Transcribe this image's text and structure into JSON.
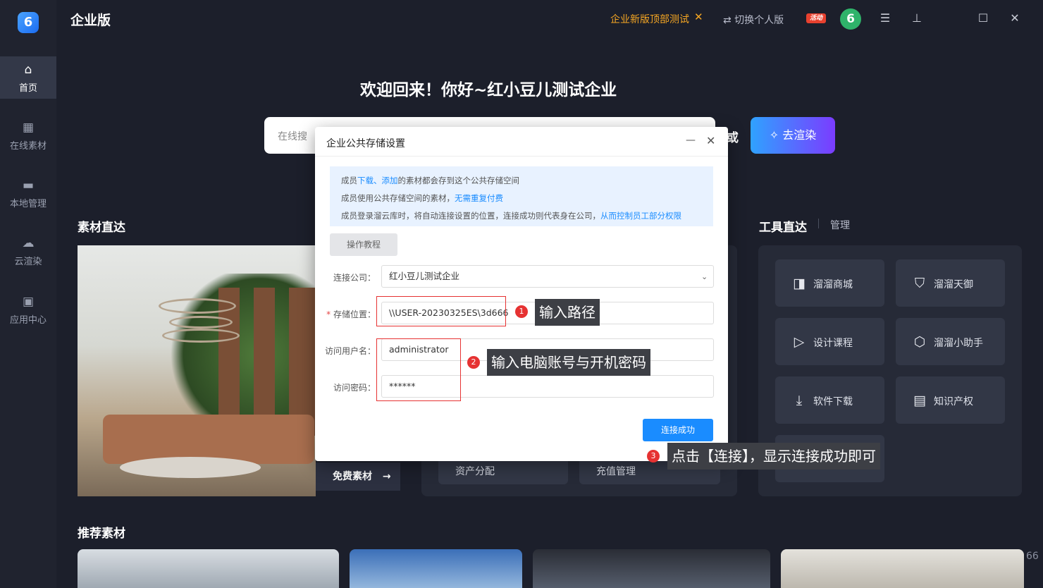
{
  "app": {
    "title": "企业版",
    "logo_glyph": "6",
    "top_notice": "企业新版顶部测试",
    "switch_personal": "⇄ 切换个人版",
    "activity_badge": "活动",
    "avatar_glyph": "6"
  },
  "sidebar": {
    "items": [
      {
        "label": "首页",
        "icon": "home-icon",
        "glyph": "⌂",
        "active": true
      },
      {
        "label": "在线素材",
        "icon": "grid-icon",
        "glyph": "▦",
        "active": false
      },
      {
        "label": "本地管理",
        "icon": "monitor-icon",
        "glyph": "▬",
        "active": false
      },
      {
        "label": "云渲染",
        "icon": "cloud-icon",
        "glyph": "☁",
        "active": false
      },
      {
        "label": "应用中心",
        "icon": "apps-icon",
        "glyph": "▣",
        "active": false
      }
    ]
  },
  "welcome": {
    "text": "欢迎回来！你好~红小豆儿测试企业",
    "search_placeholder": "在线搜",
    "or_text": "或",
    "render_button": "去渲染"
  },
  "materials": {
    "title": "素材直达",
    "free_button": "免费素材"
  },
  "middle": {
    "cards": [
      "资产分配",
      "充值管理"
    ]
  },
  "tools": {
    "title": "工具直达",
    "manage": "管理",
    "items": [
      {
        "label": "溜溜商城",
        "icon": "shopping-bag-icon",
        "glyph": "◨"
      },
      {
        "label": "溜溜天御",
        "icon": "shield-icon",
        "glyph": "⛉"
      },
      {
        "label": "设计课程",
        "icon": "play-course-icon",
        "glyph": "▷"
      },
      {
        "label": "溜溜小助手",
        "icon": "assistant-icon",
        "glyph": "⬡"
      },
      {
        "label": "软件下载",
        "icon": "download-icon",
        "glyph": "⤓"
      },
      {
        "label": "知识产权",
        "icon": "document-icon",
        "glyph": "▤"
      }
    ]
  },
  "recommended": {
    "title": "推荐素材",
    "page_number": "66"
  },
  "modal": {
    "title": "企业公共存储设置",
    "info": {
      "line1_a": "成员",
      "line1_hl": "下载、添加",
      "line1_b": "的素材都会存到这个公共存储空间",
      "line2_a": "成员使用公共存储空间的素材，",
      "line2_hl": "无需重复付费",
      "line3_a": "成员登录溜云库时，将自动连接设置的位置，连接成功则代表身在公司，",
      "line3_hl": "从而控制员工部分权限"
    },
    "tutorial_button": "操作教程",
    "company_label": "连接公司：",
    "company_value": "红小豆儿测试企业",
    "storage_label": "存储位置：",
    "storage_value": "\\\\USER-20230325ES\\3d666",
    "username_label": "访问用户名：",
    "username_value": "administrator",
    "password_label": "访问密码：",
    "password_value": "******",
    "connect_button": "连接成功"
  },
  "annotations": {
    "step1_num": "1",
    "step1_text": "输入路径",
    "step2_num": "2",
    "step2_text": "输入电脑账号与开机密码",
    "step3_num": "3",
    "step3_text": "点击【连接】，显示连接成功即可",
    "highlight_color": "#e63232"
  }
}
